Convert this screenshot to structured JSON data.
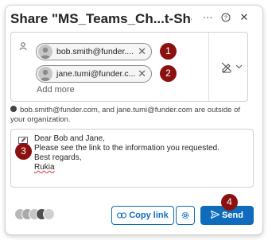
{
  "dialog": {
    "title": "Share \"MS_Teams_Ch...t-Sheet.pdf\"",
    "more_icon": "ellipsis-icon",
    "help_icon": "help-icon",
    "close_icon": "close-icon"
  },
  "recipients": {
    "chips": [
      {
        "email": "bob.smith@funder....",
        "marker": "1"
      },
      {
        "email": "jane.tumi@funder.c...",
        "marker": "2"
      }
    ],
    "add_more": "Add more",
    "permission_icon": "no-edit-pen-icon"
  },
  "notice": {
    "text": "bob.smith@funder.com, and jane.tumi@funder.com are outside of your organization."
  },
  "message": {
    "lines": [
      "Dear Bob and Jane,",
      "Please see the link to the information you requested.",
      "Best regards,",
      "Rukia"
    ],
    "marker": "3"
  },
  "footer": {
    "copy_link": "Copy link",
    "send": "Send",
    "send_marker": "4"
  },
  "colors": {
    "accent": "#0f6cbd",
    "marker": "#8b1111"
  }
}
